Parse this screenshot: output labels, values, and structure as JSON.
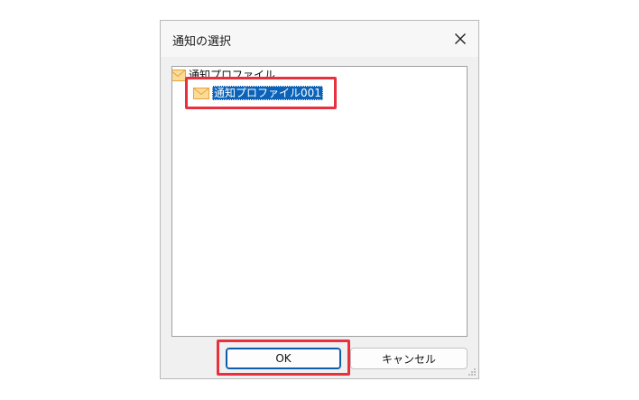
{
  "dialog": {
    "title": "通知の選択",
    "close_icon": "close-icon"
  },
  "tree": {
    "root": {
      "label": "通知プロファイル",
      "icon": "mail-icon"
    },
    "items": [
      {
        "label": "通知プロファイル001",
        "icon": "mail-icon",
        "selected": true
      }
    ]
  },
  "buttons": {
    "ok_label": "OK",
    "cancel_label": "キャンセル"
  },
  "colors": {
    "highlight": "#e8303f",
    "selection": "#0a63b8",
    "envelope": "#e8a33a"
  }
}
